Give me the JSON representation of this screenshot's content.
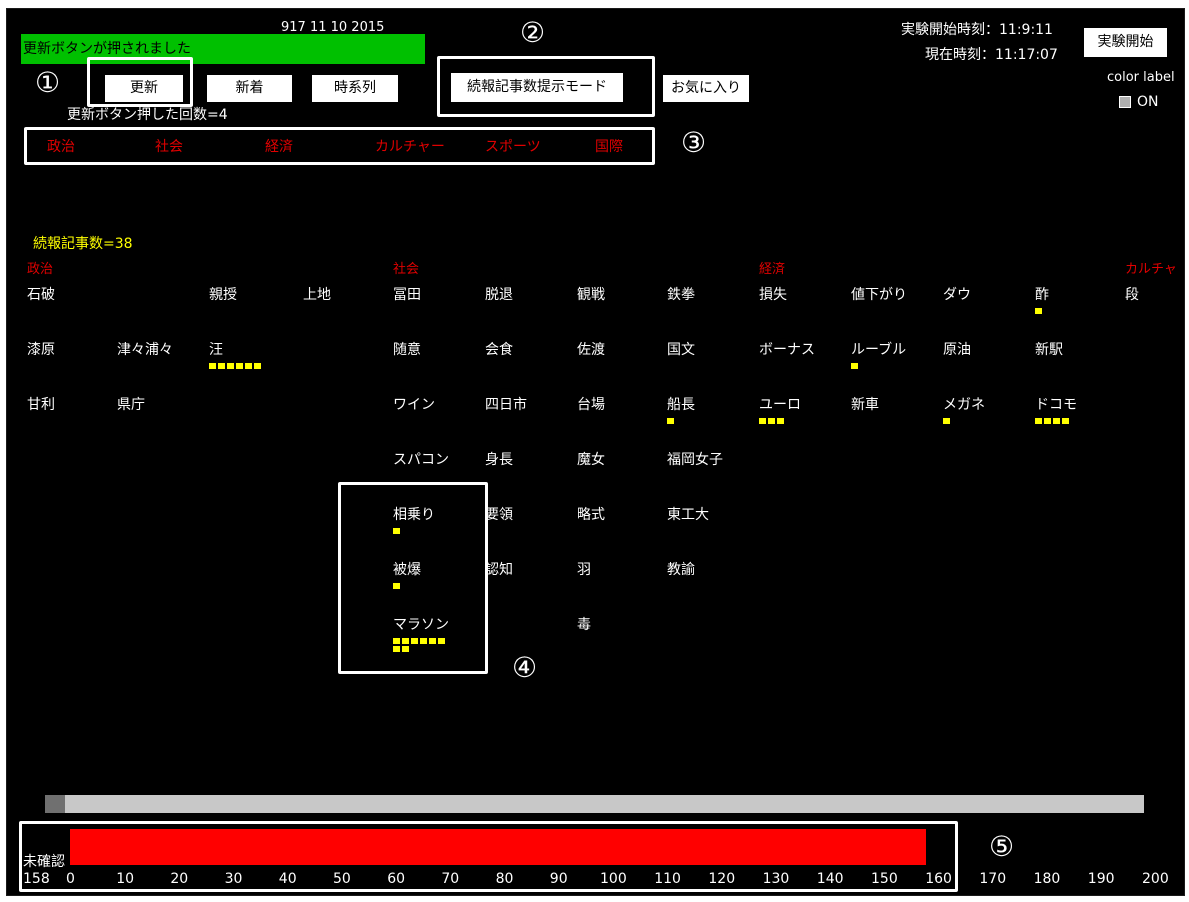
{
  "header": {
    "date": "917 11 10 2015",
    "status_message": "更新ボタンが押されました",
    "update_count": "更新ボタン押した回数=4"
  },
  "markers": [
    "①",
    "②",
    "③",
    "④",
    "⑤"
  ],
  "toolbar": {
    "update_label": "更新",
    "new_label": "新着",
    "timeline_label": "時系列",
    "mode_label": "続報記事数提示モード",
    "favorites_label": "お気に入り",
    "start_label": "実験開始"
  },
  "info": {
    "start_time": "実験開始時刻：11:9:11",
    "current_time": "現在時刻：11:17:07",
    "color_label": "color label",
    "color_toggle": "ON"
  },
  "category_tabs": [
    "政治",
    "社会",
    "経済",
    "カルチャー",
    "スポーツ",
    "国際"
  ],
  "continuation_count": "続報記事数=38",
  "columns": {
    "politics": "政治",
    "society": "社会",
    "economy": "経済",
    "culture": "カルチャ"
  },
  "keywords": [
    {
      "text": "石破",
      "dots": 0
    },
    {
      "text": "親授",
      "dots": 0
    },
    {
      "text": "上地",
      "dots": 0
    },
    {
      "text": "漆原",
      "dots": 0
    },
    {
      "text": "津々浦々",
      "dots": 0
    },
    {
      "text": "汪",
      "dots": 6
    },
    {
      "text": "甘利",
      "dots": 0
    },
    {
      "text": "県庁",
      "dots": 0
    },
    {
      "text": "冨田",
      "dots": 0
    },
    {
      "text": "脱退",
      "dots": 0
    },
    {
      "text": "観戦",
      "dots": 0
    },
    {
      "text": "鉄拳",
      "dots": 0
    },
    {
      "text": "随意",
      "dots": 0
    },
    {
      "text": "会食",
      "dots": 0
    },
    {
      "text": "佐渡",
      "dots": 0
    },
    {
      "text": "国文",
      "dots": 0
    },
    {
      "text": "ワイン",
      "dots": 0
    },
    {
      "text": "四日市",
      "dots": 0
    },
    {
      "text": "台場",
      "dots": 0
    },
    {
      "text": "船長",
      "dots": 1
    },
    {
      "text": "スパコン",
      "dots": 0
    },
    {
      "text": "身長",
      "dots": 0
    },
    {
      "text": "魔女",
      "dots": 0
    },
    {
      "text": "福岡女子",
      "dots": 0
    },
    {
      "text": "相乗り",
      "dots": 1
    },
    {
      "text": "要領",
      "dots": 0
    },
    {
      "text": "略式",
      "dots": 0
    },
    {
      "text": "東工大",
      "dots": 0
    },
    {
      "text": "被爆",
      "dots": 1
    },
    {
      "text": "認知",
      "dots": 0
    },
    {
      "text": "羽",
      "dots": 0
    },
    {
      "text": "教諭",
      "dots": 0
    },
    {
      "text": "マラソン",
      "dots": 8
    },
    {
      "text": "毒",
      "dots": 0
    },
    {
      "text": "損失",
      "dots": 0
    },
    {
      "text": "値下がり",
      "dots": 0
    },
    {
      "text": "ダウ",
      "dots": 0
    },
    {
      "text": "酢",
      "dots": 1
    },
    {
      "text": "段",
      "dots": 0
    },
    {
      "text": "ボーナス",
      "dots": 0
    },
    {
      "text": "ルーブル",
      "dots": 1
    },
    {
      "text": "原油",
      "dots": 0
    },
    {
      "text": "新駅",
      "dots": 0
    },
    {
      "text": "ユーロ",
      "dots": 3
    },
    {
      "text": "新車",
      "dots": 0
    },
    {
      "text": "メガネ",
      "dots": 1
    },
    {
      "text": "ドコモ",
      "dots": 4
    }
  ],
  "unconfirmed": {
    "label": "未確認",
    "value": 158,
    "value_text": "158",
    "max": 200,
    "ticks": [
      "0",
      "10",
      "20",
      "30",
      "40",
      "50",
      "60",
      "70",
      "80",
      "90",
      "100",
      "110",
      "120",
      "130",
      "140",
      "150",
      "160",
      "170",
      "180",
      "190",
      "200"
    ]
  },
  "colors": {
    "status_green": "#00c000",
    "category_red": "#e00000",
    "count_yellow": "#ffff00",
    "bar_red": "#ff0000"
  }
}
